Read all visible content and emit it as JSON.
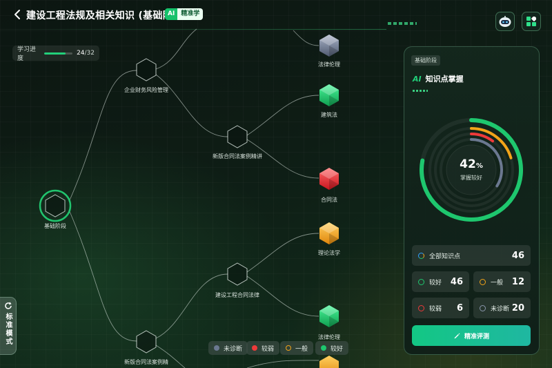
{
  "header": {
    "title": "建设工程法规及相关知识 (基础阶段)",
    "badge_ai": "AI",
    "badge_label": "精准学"
  },
  "progress": {
    "label": "学习进度",
    "done": 24,
    "total": 32,
    "count_text": "24",
    "total_text": "/32"
  },
  "tree": {
    "root": "基础阶段",
    "nodes": {
      "n1": "企业财务风险管理",
      "n2": "新版合同法案例精讲",
      "n3": "建设工程合同法律",
      "n4": "新版合同法案例精",
      "l1": "法律伦理",
      "l2": "建筑法",
      "l3": "合同法",
      "l4": "理论法学",
      "l5": "法律伦理"
    }
  },
  "legend": {
    "undiag": "未诊断",
    "weak": "较弱",
    "normal": "一般",
    "good": "较好"
  },
  "side_tab": "标准模式",
  "panel": {
    "stage": "基础阶段",
    "title_ai": "AI",
    "title": "知识点掌握",
    "percent": "42",
    "percent_unit": "%",
    "status": "掌握较好",
    "all_label": "全部知识点",
    "all_count": "46",
    "stats": {
      "good_label": "较好",
      "good_count": "46",
      "normal_label": "一般",
      "normal_count": "12",
      "weak_label": "较弱",
      "weak_count": "6",
      "undiag_label": "未诊断",
      "undiag_count": "20"
    },
    "eval_button": "精准评测"
  },
  "colors": {
    "good": "#1ec76e",
    "normal": "#f2a419",
    "weak": "#ee3a3a",
    "undiag": "#6b7890",
    "accent": "#22d07a"
  }
}
